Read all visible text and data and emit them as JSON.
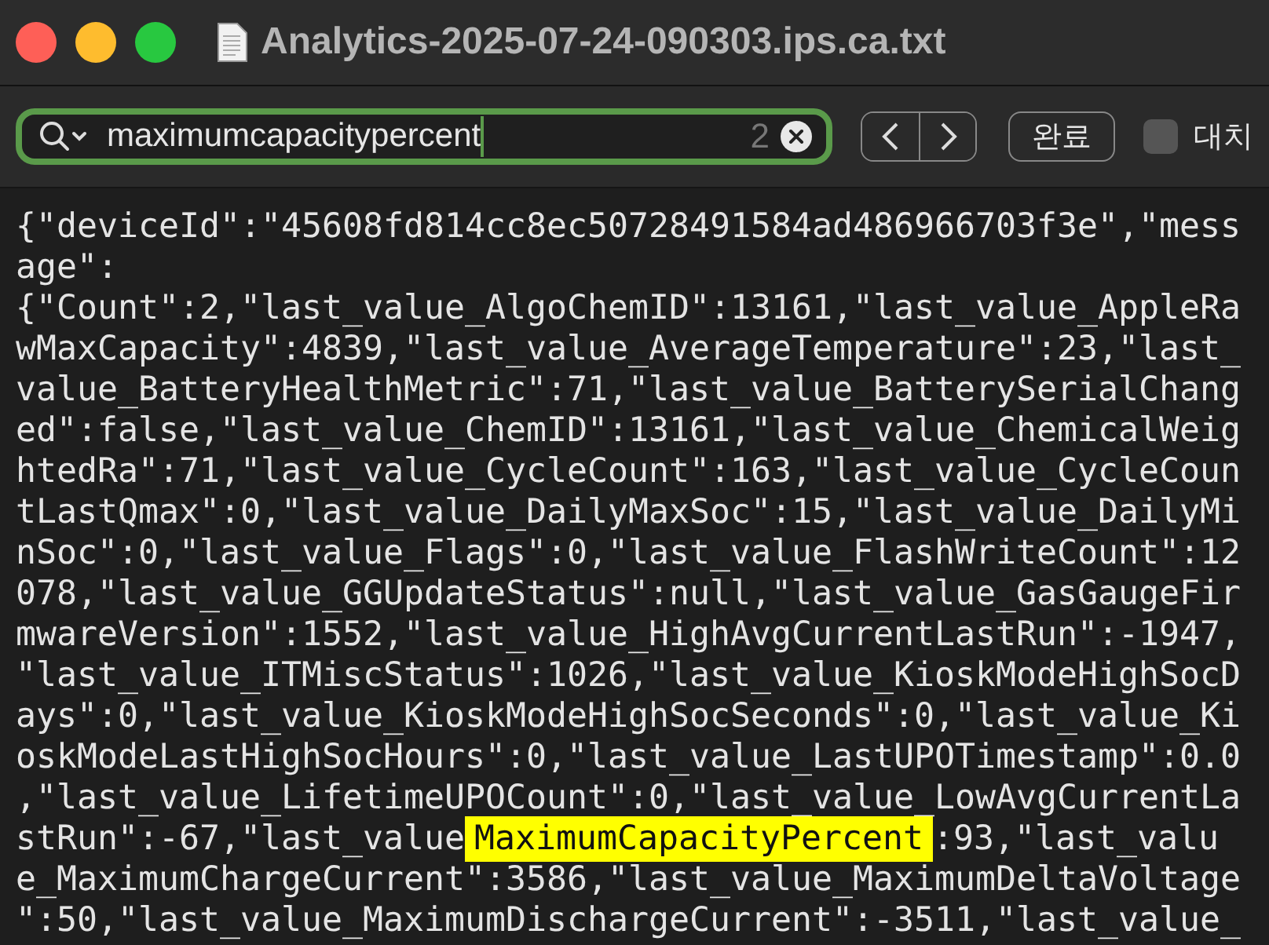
{
  "window": {
    "title": "Analytics-2025-07-24-090303.ips.ca.txt"
  },
  "find_bar": {
    "query": "maximumcapacitypercent",
    "match_count": "2",
    "done_button": "완료",
    "replace": {
      "label": "대치",
      "checked": false
    }
  },
  "document": {
    "lines": [
      {
        "segments": [
          {
            "text": "{\"deviceId\":\"45608fd814cc8ec50728491584ad486966703f3e\",\"mess",
            "highlighted": false
          }
        ]
      },
      {
        "segments": [
          {
            "text": "age\":",
            "highlighted": false
          }
        ]
      },
      {
        "segments": [
          {
            "text": "{\"Count\":2,\"last_value_AlgoChemID\":13161,\"last_value_AppleRa",
            "highlighted": false
          }
        ]
      },
      {
        "segments": [
          {
            "text": "wMaxCapacity\":4839,\"last_value_AverageTemperature\":23,\"last_",
            "highlighted": false
          }
        ]
      },
      {
        "segments": [
          {
            "text": "value_BatteryHealthMetric\":71,\"last_value_BatterySerialChang",
            "highlighted": false
          }
        ]
      },
      {
        "segments": [
          {
            "text": "ed\":false,\"last_value_ChemID\":13161,\"last_value_ChemicalWeig",
            "highlighted": false
          }
        ]
      },
      {
        "segments": [
          {
            "text": "htedRa\":71,\"last_value_CycleCount\":163,\"last_value_CycleCoun",
            "highlighted": false
          }
        ]
      },
      {
        "segments": [
          {
            "text": "tLastQmax\":0,\"last_value_DailyMaxSoc\":15,\"last_value_DailyMi",
            "highlighted": false
          }
        ]
      },
      {
        "segments": [
          {
            "text": "nSoc\":0,\"last_value_Flags\":0,\"last_value_FlashWriteCount\":12",
            "highlighted": false
          }
        ]
      },
      {
        "segments": [
          {
            "text": "078,\"last_value_GGUpdateStatus\":null,\"last_value_GasGaugeFir",
            "highlighted": false
          }
        ]
      },
      {
        "segments": [
          {
            "text": "mwareVersion\":1552,\"last_value_HighAvgCurrentLastRun\":-1947,",
            "highlighted": false
          }
        ]
      },
      {
        "segments": [
          {
            "text": "\"last_value_ITMiscStatus\":1026,\"last_value_KioskModeHighSocD",
            "highlighted": false
          }
        ]
      },
      {
        "segments": [
          {
            "text": "ays\":0,\"last_value_KioskModeHighSocSeconds\":0,\"last_value_Ki",
            "highlighted": false
          }
        ]
      },
      {
        "segments": [
          {
            "text": "oskModeLastHighSocHours\":0,\"last_value_LastUPOTimestamp\":0.0",
            "highlighted": false
          }
        ]
      },
      {
        "segments": [
          {
            "text": ",\"last_value_LifetimeUPOCount\":0,\"last_value_LowAvgCurrentLa",
            "highlighted": false
          }
        ]
      },
      {
        "segments": [
          {
            "text": "stRun\":-67,\"last_value",
            "highlighted": false
          },
          {
            "text": "MaximumCapacityPercent",
            "highlighted": true
          },
          {
            "text": ":93,\"last_valu",
            "highlighted": false
          }
        ]
      },
      {
        "segments": [
          {
            "text": "e_MaximumChargeCurrent\":3586,\"last_value_MaximumDeltaVoltage",
            "highlighted": false
          }
        ]
      },
      {
        "segments": [
          {
            "text": "\":50,\"last_value_MaximumDischargeCurrent\":-3511,\"last_value_",
            "highlighted": false
          }
        ]
      }
    ]
  }
}
